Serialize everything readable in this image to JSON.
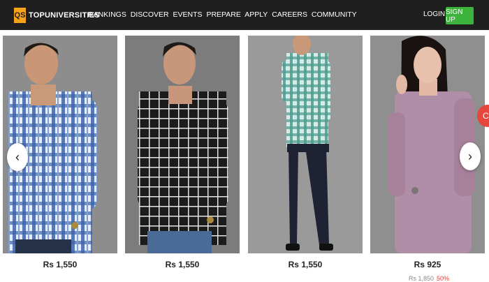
{
  "header": {
    "logo_mark": "QS",
    "logo_text": "TOPUNIVERSITIES",
    "nav": [
      "RANKINGS",
      "DISCOVER",
      "EVENTS",
      "PREPARE",
      "APPLY",
      "CAREERS",
      "COMMUNITY"
    ],
    "login": "LOGIN",
    "signup": "SIGN UP"
  },
  "products": [
    {
      "price": "Rs 1,550",
      "image": "man-blue-white-check-shirt"
    },
    {
      "price": "Rs 1,550",
      "image": "man-black-check-shirt"
    },
    {
      "price": "Rs 1,550",
      "image": "man-green-check-shirt"
    },
    {
      "price": "Rs 925",
      "image": "woman-mauve-satin-shirt"
    }
  ],
  "carousel": {
    "prev_icon": "‹",
    "next_icon": "›"
  },
  "partial": {
    "old_price": "Rs 1,850",
    "discount": "50%",
    "side_icon": "C"
  },
  "colors": {
    "topbar": "#1f1f1f",
    "logo_accent": "#f7a21b",
    "signup": "#3cb43c"
  }
}
